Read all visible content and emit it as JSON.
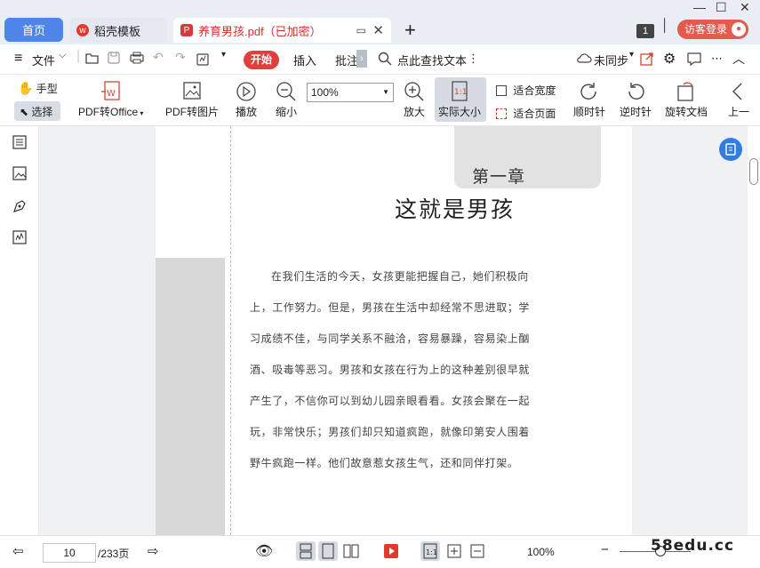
{
  "tabs": {
    "home_label": "首页",
    "template_label": "稻壳模板",
    "doc_label": "养育男孩.pdf（已加密）"
  },
  "window": {
    "badge_count": "1",
    "login_label": "访客登录",
    "minimize": "—",
    "maximize": "☐",
    "close": "✕"
  },
  "menu": {
    "file_label": "文件",
    "start_label": "开始",
    "insert_label": "插入",
    "annotate_label": "批注",
    "search_label": "点此查找文本",
    "sync_label": "未同步"
  },
  "ribbon": {
    "hand_label": "手型",
    "select_label": "选择",
    "pdf_to_office_label": "PDF转Office",
    "pdf_to_image_label": "PDF转图片",
    "play_label": "播放",
    "zoom_out_label": "缩小",
    "zoom_value": "100%",
    "zoom_in_label": "放大",
    "actual_size_label": "实际大小",
    "fit_width_label": "适合宽度",
    "fit_page_label": "适合页面",
    "rotate_cw_label": "顺时针",
    "rotate_ccw_label": "逆时针",
    "rotate_doc_label": "旋转文档",
    "prev_label": "上一"
  },
  "document": {
    "chapter": "第一章",
    "title": "这就是男孩",
    "lines": [
      "在我们生活的今天，女孩更能把握自己，她们积极向",
      "上，工作努力。但是，男孩在生活中却经常不思进取；学",
      "习成绩不佳，与同学关系不融洽，容易暴躁，容易染上酗",
      "酒、吸毒等恶习。男孩和女孩在行为上的这种差别很早就",
      "产生了，不信你可以到幼儿园亲眼看看。女孩会聚在一起",
      "玩，非常快乐；男孩们却只知道疯跑，就像印第安人围着",
      "野牛疯跑一样。他们故意惹女孩生气，还和同伴打架。"
    ]
  },
  "status": {
    "current_page": "10",
    "total_pages": "/233页",
    "zoom_value": "100%",
    "watermark": "58edu.cc"
  }
}
